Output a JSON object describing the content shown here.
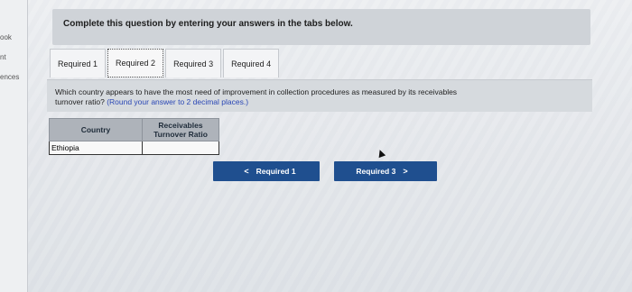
{
  "sidebar": {
    "items": [
      "ook",
      "nt",
      "ences"
    ]
  },
  "instructions": "Complete this question by entering your answers in the tabs below.",
  "tabs": [
    {
      "label": "Required 1",
      "active": false
    },
    {
      "label": "Required 2",
      "active": true
    },
    {
      "label": "Required 3",
      "active": false
    },
    {
      "label": "Required 4",
      "active": false
    }
  ],
  "question": {
    "line1": "Which country appears to have the most need of improvement in collection procedures as measured by its receivables",
    "line2": "turnover ratio?",
    "hint": "(Round your answer to 2 decimal places.)"
  },
  "table": {
    "headers": {
      "country": "Country",
      "ratio_line1": "Receivables",
      "ratio_line2": "Turnover Ratio"
    },
    "row": {
      "country": "Ethiopia",
      "ratio": ""
    }
  },
  "nav": {
    "prev_label": "Required 1",
    "next_label": "Required 3",
    "prev_icon": "chevron-left-icon",
    "next_icon": "chevron-right-icon"
  },
  "colors": {
    "nav_button": "#1f4f8f",
    "hint_text": "#2a47b5",
    "header_bg": "#aeb3ba"
  }
}
